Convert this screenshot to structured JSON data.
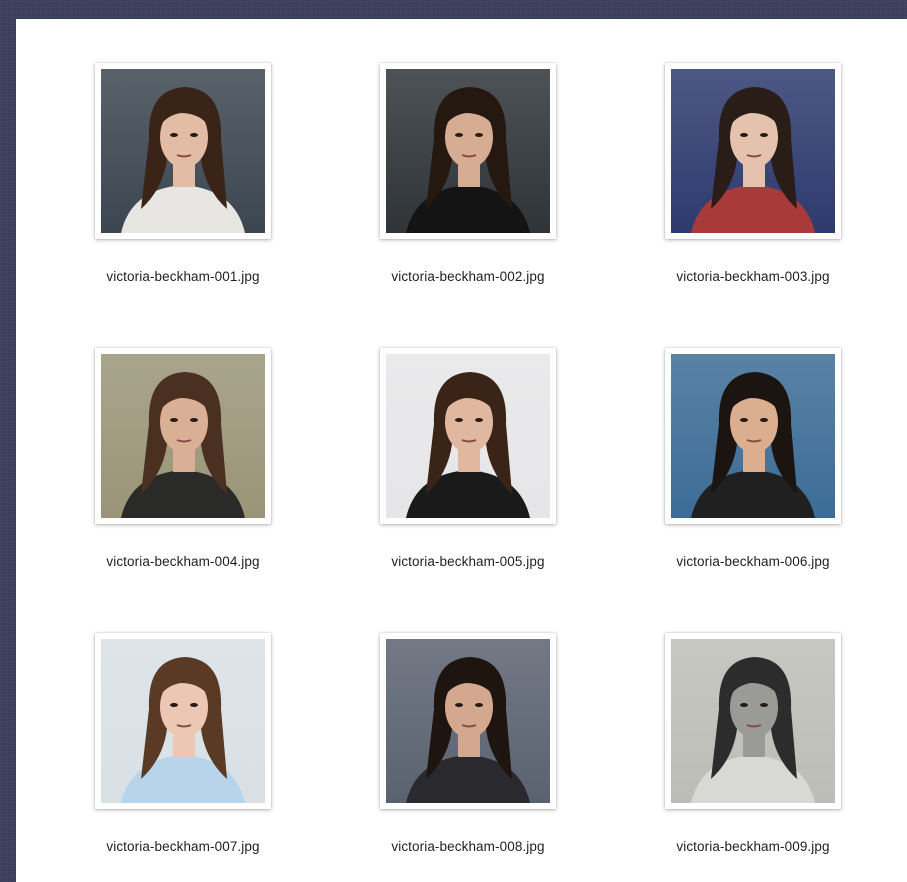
{
  "files": [
    {
      "name": "victoria-beckham-001.jpg",
      "thumb": {
        "bg": "#3c4650",
        "hair": "#3a2418",
        "skin": "#e2bca4",
        "top": "#e8e6e2",
        "icon": "portrait-photo-icon"
      }
    },
    {
      "name": "victoria-beckham-002.jpg",
      "thumb": {
        "bg": "#2f3438",
        "hair": "#251810",
        "skin": "#d6ad92",
        "top": "#141414",
        "icon": "portrait-photo-icon"
      }
    },
    {
      "name": "victoria-beckham-003.jpg",
      "thumb": {
        "bg": "#2e3a6e",
        "hair": "#2a1c16",
        "skin": "#e4c2ae",
        "top": "#a83a3a",
        "icon": "portrait-photo-icon"
      }
    },
    {
      "name": "victoria-beckham-004.jpg",
      "thumb": {
        "bg": "#9a9478",
        "hair": "#4a3020",
        "skin": "#d9b096",
        "top": "#2a2a28",
        "icon": "portrait-photo-icon"
      }
    },
    {
      "name": "victoria-beckham-005.jpg",
      "thumb": {
        "bg": "#e6e6e8",
        "hair": "#3a2418",
        "skin": "#e0b8a0",
        "top": "#1a1a1a",
        "icon": "portrait-photo-icon"
      }
    },
    {
      "name": "victoria-beckham-006.jpg",
      "thumb": {
        "bg": "#3c6c96",
        "hair": "#1c1410",
        "skin": "#dcae90",
        "top": "#202020",
        "icon": "portrait-photo-icon"
      }
    },
    {
      "name": "victoria-beckham-007.jpg",
      "thumb": {
        "bg": "#d8e0e6",
        "hair": "#5a3a24",
        "skin": "#ecc8b4",
        "top": "#b8d4ea",
        "icon": "portrait-photo-icon"
      }
    },
    {
      "name": "victoria-beckham-008.jpg",
      "thumb": {
        "bg": "#5a6270",
        "hair": "#1e1410",
        "skin": "#d4a88e",
        "top": "#2a2a2e",
        "icon": "portrait-photo-icon"
      }
    },
    {
      "name": "victoria-beckham-009.jpg",
      "thumb": {
        "bg": "#bdbdb8",
        "hair": "#2c2c2c",
        "skin": "#9a9a96",
        "top": "#d8d8d4",
        "icon": "portrait-photo-icon"
      }
    }
  ]
}
